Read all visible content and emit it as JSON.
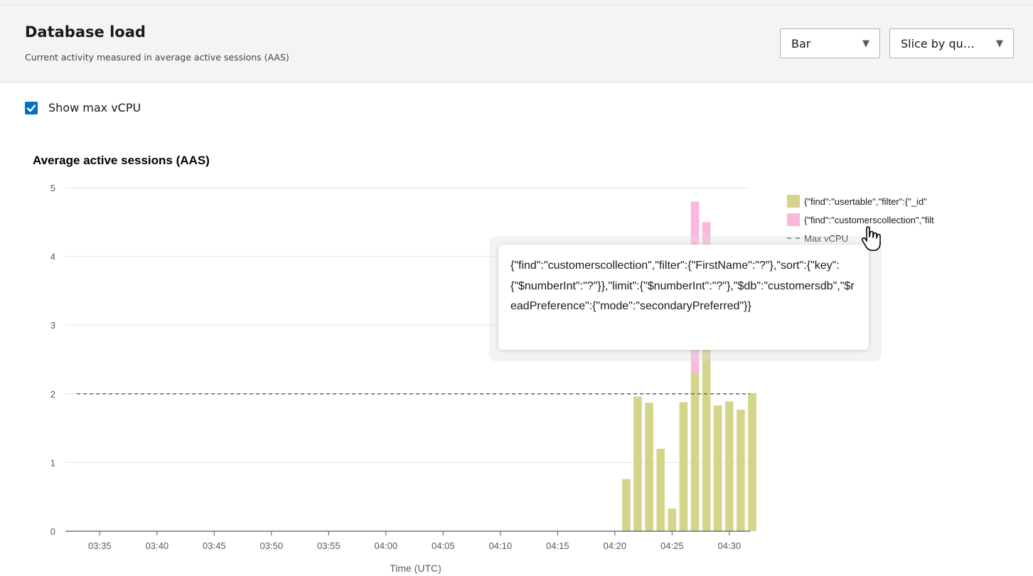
{
  "header": {
    "title": "Database load",
    "subtitle": "Current activity measured in average active sessions (AAS)",
    "chart_type_dropdown": "Bar",
    "slice_dropdown": "Slice by qu…"
  },
  "options": {
    "show_max_vcpu_label": "Show max vCPU",
    "show_max_vcpu_checked": true
  },
  "tooltip": {
    "text": "{\"find\":\"customerscollection\",\"filter\":{\"FirstName\":\"?\"},\"sort\":{\"key\":{\"$numberInt\":\"?\"}},\"limit\":{\"$numberInt\":\"?\"},\"$db\":\"customersdb\",\"$readPreference\":{\"mode\":\"secondaryPreferred\"}}"
  },
  "colors": {
    "usertable": "#d4d58a",
    "customerscollection": "#f9b8dc",
    "max_vcpu": "#687078",
    "checkbox": "#0073bb"
  },
  "chart_data": {
    "type": "bar",
    "stacked": true,
    "title": "Average active sessions (AAS)",
    "xlabel": "Time (UTC)",
    "ylabel": "",
    "ylim": [
      0,
      5
    ],
    "yticks": [
      0,
      1,
      2,
      3,
      4,
      5
    ],
    "xticks": [
      "03:35",
      "03:40",
      "03:45",
      "03:50",
      "03:55",
      "04:00",
      "04:05",
      "04:10",
      "04:15",
      "04:20",
      "04:25",
      "04:30"
    ],
    "x_range": [
      "03:32",
      "04:32"
    ],
    "categories": [
      "04:21",
      "04:22",
      "04:23",
      "04:24",
      "04:25",
      "04:26",
      "04:27",
      "04:28",
      "04:29",
      "04:30",
      "04:31",
      "04:32"
    ],
    "series": [
      {
        "name": "{\"find\":\"usertable\",\"filter\":{\"_id\"",
        "color": "#d4d58a",
        "values": [
          0.76,
          1.96,
          1.87,
          1.2,
          0.33,
          1.88,
          2.3,
          3.4,
          1.83,
          1.89,
          1.77,
          2.01
        ]
      },
      {
        "name": "{\"find\":\"customerscollection\",\"filt",
        "color": "#f9b8dc",
        "values": [
          0,
          0,
          0,
          0,
          0,
          0,
          2.5,
          1.1,
          0,
          0,
          0,
          0
        ]
      }
    ],
    "reference_line": {
      "name": "Max vCPU",
      "value": 2,
      "style": "dashed"
    },
    "legend_position": "right",
    "grid": true
  }
}
